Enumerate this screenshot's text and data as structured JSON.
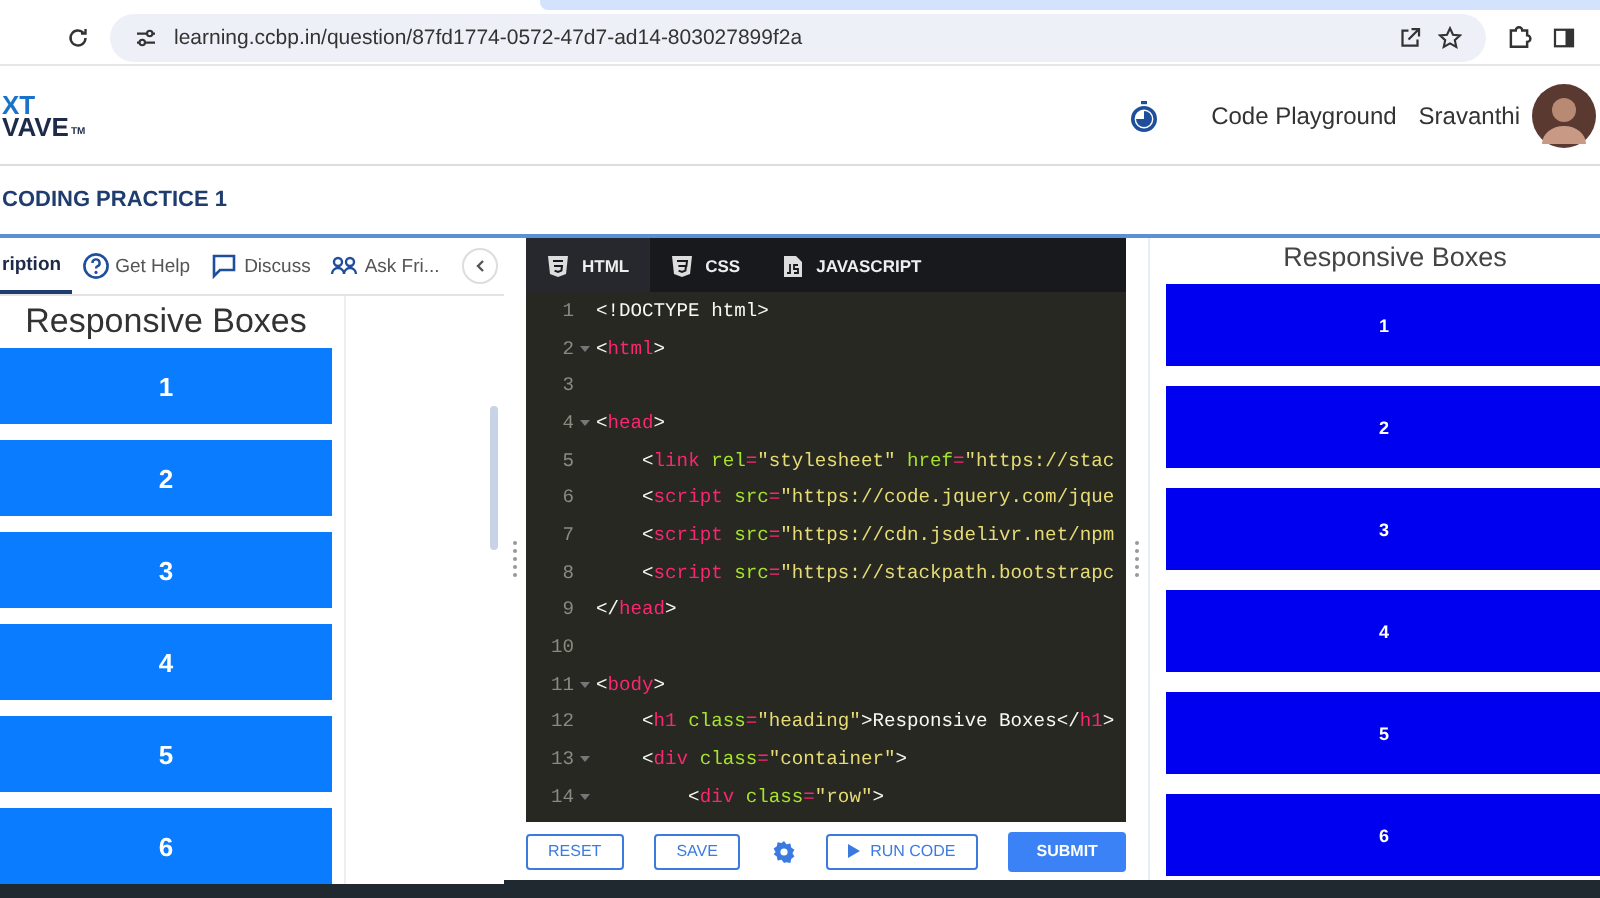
{
  "browser": {
    "url": "learning.ccbp.in/question/87fd1774-0572-47d7-ad14-803027899f2a"
  },
  "header": {
    "logo": {
      "line_1": "XT",
      "line_2": "VAVE",
      "mark": "TM"
    },
    "link": "Code Playground",
    "user": "Sravanthi"
  },
  "breadcrumb": "CODING PRACTICE 1",
  "left_panel": {
    "tabs": [
      {
        "label": "ription",
        "selected": true,
        "kind": "description"
      },
      {
        "label": "Get Help",
        "selected": false,
        "kind": "help"
      },
      {
        "label": "Discuss",
        "selected": false,
        "kind": "discuss"
      },
      {
        "label": "Ask Fri...",
        "selected": false,
        "kind": "friends"
      }
    ],
    "preview": {
      "heading": "Responsive Boxes",
      "boxes": [
        "1",
        "2",
        "3",
        "4",
        "5",
        "6"
      ]
    }
  },
  "editor": {
    "tabs": [
      {
        "label": "HTML",
        "selected": true,
        "kind": "html"
      },
      {
        "label": "CSS",
        "selected": false,
        "kind": "css"
      },
      {
        "label": "JAVASCRIPT",
        "selected": false,
        "kind": "js"
      }
    ],
    "lines": [
      {
        "number": "1",
        "foldable": false,
        "tokens": [
          {
            "kind": "plain",
            "text": "<!DOCTYPE html>"
          }
        ]
      },
      {
        "number": "2",
        "foldable": true,
        "tokens": [
          {
            "kind": "plain",
            "text": "<"
          },
          {
            "kind": "tag",
            "text": "html"
          },
          {
            "kind": "plain",
            "text": ">"
          }
        ]
      },
      {
        "number": "3",
        "foldable": false
      },
      {
        "number": "4",
        "foldable": true,
        "tokens": [
          {
            "kind": "plain",
            "text": "<"
          },
          {
            "kind": "tag",
            "text": "head"
          },
          {
            "kind": "plain",
            "text": ">"
          }
        ]
      },
      {
        "number": "5",
        "foldable": false,
        "tokens": [
          {
            "kind": "plain",
            "text": "    <"
          },
          {
            "kind": "tag",
            "text": "link"
          },
          {
            "kind": "attr",
            "text": " rel"
          },
          {
            "kind": "tag",
            "text": "="
          },
          {
            "kind": "string",
            "text": "\"stylesheet\""
          },
          {
            "kind": "attr",
            "text": " href"
          },
          {
            "kind": "tag",
            "text": "="
          },
          {
            "kind": "string",
            "text": "\"https://stac"
          }
        ]
      },
      {
        "number": "6",
        "foldable": false,
        "tokens": [
          {
            "kind": "plain",
            "text": "    <"
          },
          {
            "kind": "tag",
            "text": "script"
          },
          {
            "kind": "attr",
            "text": " src"
          },
          {
            "kind": "tag",
            "text": "="
          },
          {
            "kind": "string",
            "text": "\"https://code.jquery.com/jque"
          }
        ]
      },
      {
        "number": "7",
        "foldable": false,
        "tokens": [
          {
            "kind": "plain",
            "text": "    <"
          },
          {
            "kind": "tag",
            "text": "script"
          },
          {
            "kind": "attr",
            "text": " src"
          },
          {
            "kind": "tag",
            "text": "="
          },
          {
            "kind": "string",
            "text": "\"https://cdn.jsdelivr.net/npm"
          }
        ]
      },
      {
        "number": "8",
        "foldable": false,
        "tokens": [
          {
            "kind": "plain",
            "text": "    <"
          },
          {
            "kind": "tag",
            "text": "script"
          },
          {
            "kind": "attr",
            "text": " src"
          },
          {
            "kind": "tag",
            "text": "="
          },
          {
            "kind": "string",
            "text": "\"https://stackpath.bootstrapc"
          }
        ]
      },
      {
        "number": "9",
        "foldable": false,
        "tokens": [
          {
            "kind": "plain",
            "text": "</"
          },
          {
            "kind": "tag",
            "text": "head"
          },
          {
            "kind": "plain",
            "text": ">"
          }
        ]
      },
      {
        "number": "10",
        "foldable": false
      },
      {
        "number": "11",
        "foldable": true,
        "tokens": [
          {
            "kind": "plain",
            "text": "<"
          },
          {
            "kind": "tag",
            "text": "body"
          },
          {
            "kind": "plain",
            "text": ">"
          }
        ]
      },
      {
        "number": "12",
        "foldable": false,
        "tokens": [
          {
            "kind": "plain",
            "text": "    <"
          },
          {
            "kind": "tag",
            "text": "h1"
          },
          {
            "kind": "attr",
            "text": " class"
          },
          {
            "kind": "tag",
            "text": "="
          },
          {
            "kind": "string",
            "text": "\"heading\""
          },
          {
            "kind": "plain",
            "text": ">Responsive Boxes</"
          },
          {
            "kind": "tag",
            "text": "h1"
          },
          {
            "kind": "plain",
            "text": ">"
          }
        ]
      },
      {
        "number": "13",
        "foldable": true,
        "tokens": [
          {
            "kind": "plain",
            "text": "    <"
          },
          {
            "kind": "tag",
            "text": "div"
          },
          {
            "kind": "attr",
            "text": " class"
          },
          {
            "kind": "tag",
            "text": "="
          },
          {
            "kind": "string",
            "text": "\"container\""
          },
          {
            "kind": "plain",
            "text": ">"
          }
        ]
      },
      {
        "number": "14",
        "foldable": true,
        "tokens": [
          {
            "kind": "plain",
            "text": "        <"
          },
          {
            "kind": "tag",
            "text": "div"
          },
          {
            "kind": "attr",
            "text": " class"
          },
          {
            "kind": "tag",
            "text": "="
          },
          {
            "kind": "string",
            "text": "\"row\""
          },
          {
            "kind": "plain",
            "text": ">"
          }
        ]
      }
    ]
  },
  "toolbar": [
    {
      "kind": "outline",
      "label": "RESET"
    },
    {
      "kind": "outline",
      "label": "SAVE"
    },
    {
      "kind": "settings"
    },
    {
      "kind": "run",
      "label": "RUN CODE"
    },
    {
      "kind": "primary",
      "label": "SUBMIT"
    }
  ],
  "output": {
    "heading": "Responsive Boxes",
    "boxes": [
      "1",
      "2",
      "3",
      "4",
      "5",
      "6"
    ]
  }
}
